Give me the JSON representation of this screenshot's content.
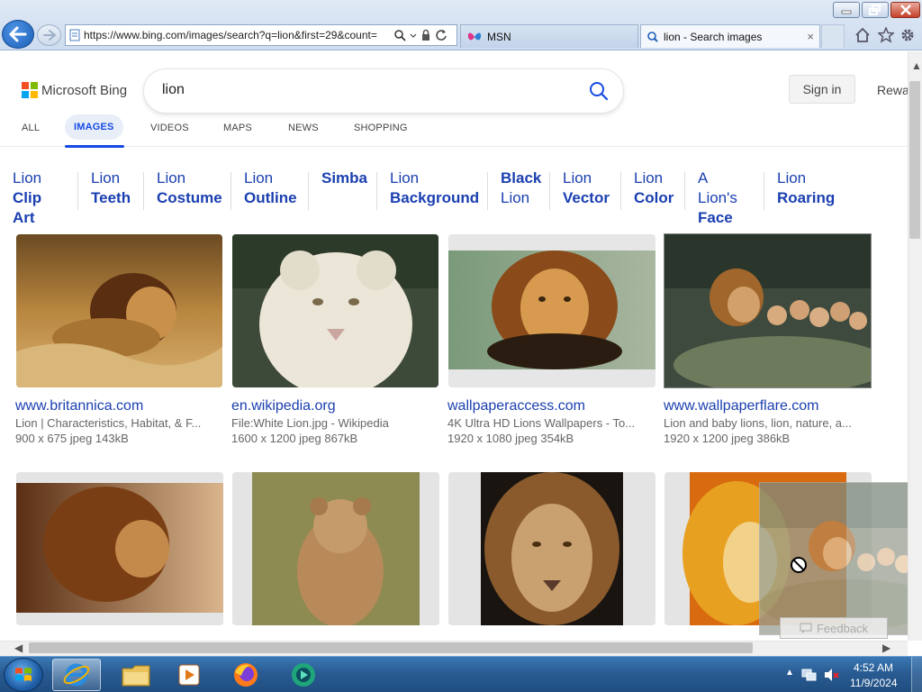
{
  "browser": {
    "address": "https://www.bing.com/images/search?q=lion&first=29&count=",
    "tabs": [
      {
        "label": "MSN"
      },
      {
        "label": "lion - Search images"
      }
    ],
    "tab_close": "×"
  },
  "bing": {
    "logo_text": "Microsoft Bing",
    "query": "lion",
    "sign_in": "Sign in",
    "rewards": "Rewa",
    "nav": [
      "ALL",
      "IMAGES",
      "VIDEOS",
      "MAPS",
      "NEWS",
      "SHOPPING"
    ],
    "chips": [
      {
        "line1": "Lion",
        "line2": "Clip Art"
      },
      {
        "line1": "Lion",
        "line2": "Teeth"
      },
      {
        "line1": "Lion",
        "line2": "Costume"
      },
      {
        "line1": "Lion",
        "line2": "Outline"
      },
      {
        "line1": "Simba",
        "line2": ""
      },
      {
        "line1": "Lion",
        "line2": "Background"
      },
      {
        "line1": "Black",
        "line2": "Lion"
      },
      {
        "line1": "Lion",
        "line2": "Vector"
      },
      {
        "line1": "Lion",
        "line2": "Color"
      },
      {
        "line1": "A Lion's",
        "line2": "Face"
      },
      {
        "line1": "Lion",
        "line2": "Roaring"
      }
    ],
    "results": [
      {
        "host": "www.britannica.com",
        "desc": "Lion | Characteristics, Habitat, & F...",
        "meta": "900 x 675 jpeg 143kB"
      },
      {
        "host": "en.wikipedia.org",
        "desc": "File:White Lion.jpg - Wikipedia",
        "meta": "1600 x 1200 jpeg 867kB"
      },
      {
        "host": "wallpaperaccess.com",
        "desc": "4K Ultra HD Lions Wallpapers - To...",
        "meta": "1920 x 1080 jpeg 354kB"
      },
      {
        "host": "www.wallpaperflare.com",
        "desc": "Lion and baby lions, lion, nature, a...",
        "meta": "1920 x 1200 jpeg 386kB"
      }
    ],
    "feedback": "Feedback"
  },
  "taskbar": {
    "time": "4:52 AM",
    "date": "11/9/2024"
  },
  "colors": {
    "link_blue": "#1a3fb0",
    "accent_blue": "#174ae4",
    "taskbar": "#295c93"
  },
  "icons": [
    "back-arrow-icon",
    "forward-arrow-icon",
    "search-icon",
    "lock-icon",
    "refresh-icon",
    "home-icon",
    "star-icon",
    "gear-icon",
    "feedback-icon",
    "no-drop-icon"
  ]
}
